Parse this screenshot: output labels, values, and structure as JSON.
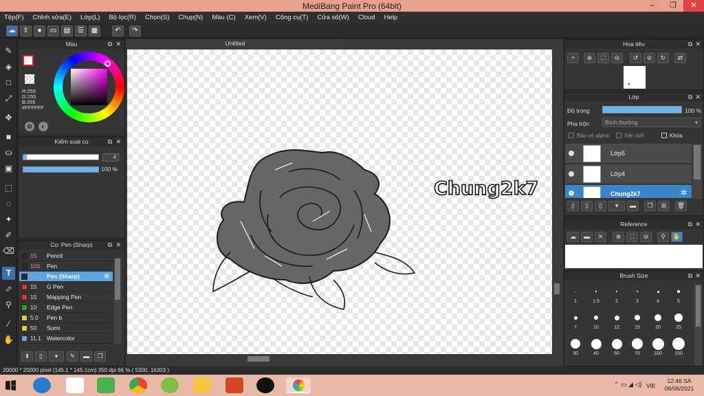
{
  "window": {
    "title": "MediBang Paint Pro (64bit)",
    "min": "–",
    "restore": "❐",
    "close": "✕"
  },
  "menu": [
    "Tệp(F)",
    "Chỉnh sửa(E)",
    "Lớp(L)",
    "Bộ lọc(R)",
    "Chọn(S)",
    "Chụp(N)",
    "Màu (C)",
    "Xem(V)",
    "Công cụ(T)",
    "Cửa số(W)",
    "Cloud",
    "Help"
  ],
  "color_panel": {
    "title": "Màu",
    "r": "R:255",
    "g": "G:255",
    "b": "B:255",
    "hex": "#FFFFFF"
  },
  "control_panel": {
    "title": "Kiểm soát cọ",
    "size": "4",
    "opacity": "100 %"
  },
  "brush_panel": {
    "title": "Cọ: Pen (Sharp)",
    "brushes": [
      {
        "size": "15",
        "name": "Pencil",
        "color": "#2b2b2b"
      },
      {
        "size": "100",
        "name": "Pen",
        "color": "#2b2b2b"
      },
      {
        "size": "4",
        "name": "Pen (Sharp)",
        "color": "#2b2b2b",
        "selected": true
      },
      {
        "size": "15",
        "name": "G Pen",
        "color": "#e23030"
      },
      {
        "size": "15",
        "name": "Mapping Pen",
        "color": "#e23030"
      },
      {
        "size": "10",
        "name": "Edge Pen",
        "color": "#2aa62a"
      },
      {
        "size": "5.0",
        "name": "Pen b",
        "color": "#e0d020"
      },
      {
        "size": "50",
        "name": "Sumi",
        "color": "#e0d020"
      },
      {
        "size": "11.1",
        "name": "Watercolor",
        "color": "#5ab0e8"
      }
    ]
  },
  "canvas": {
    "tab": "Untitled",
    "text": "Chung2k7"
  },
  "navigator": {
    "title": "Hoa tiêu"
  },
  "layers": {
    "title": "Lớp",
    "opacity_label": "Độ trong",
    "opacity_value": "100 %",
    "blend_label": "Pha trộn",
    "blend_value": "Bình thường",
    "protect_alpha": "Bảo vệ alpha",
    "clipping": "Xén bớt",
    "lock": "Khóa",
    "items": [
      {
        "name": "Lớp5"
      },
      {
        "name": "Lớp4"
      },
      {
        "name": "Chung2k7",
        "selected": true
      }
    ]
  },
  "reference": {
    "title": "Reference"
  },
  "brush_size": {
    "title": "Brush Size",
    "row1": [
      "1",
      "1.5",
      "2",
      "3",
      "4",
      "5"
    ],
    "row2": [
      "7",
      "10",
      "12",
      "15",
      "20",
      "25"
    ],
    "row3": [
      "30",
      "40",
      "50",
      "70",
      "100",
      "150"
    ]
  },
  "status": {
    "text": "20000 * 20000 pixel  (145.1 * 145.1cm)  350 dpi  66 %  ( 5300, 16303 )"
  },
  "taskbar": {
    "lang": "VIE",
    "time": "12:46 SA",
    "date": "06/06/2021"
  }
}
